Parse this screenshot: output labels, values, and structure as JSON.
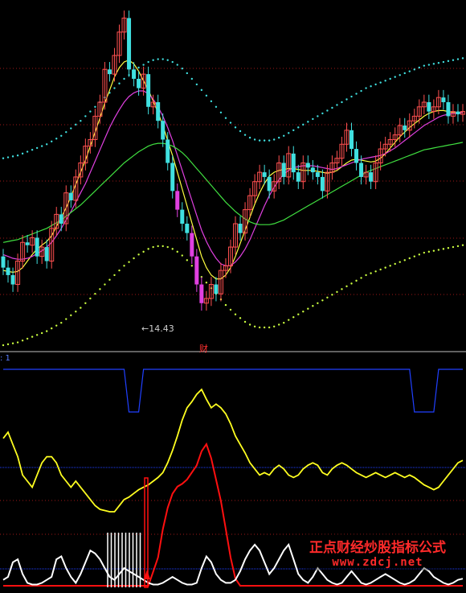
{
  "price_panel": {
    "min_label": "←14.43",
    "div_marker": "财"
  },
  "indicator_panel": {
    "tag": ": 1"
  },
  "watermark": {
    "chinese": "正点财经炒股指标公式",
    "url": "www.zdcj.net"
  },
  "colors": {
    "background": "#000000",
    "up_candle": "#ff5050",
    "down_candle": "#40e0e0",
    "big_down_candle": "#e040e0",
    "ma_short": "#ffff40",
    "ma_mid": "#e040e0",
    "ma_long": "#40e040",
    "band_upper": "#40e0e0",
    "band_lower": "#ccff40",
    "grid": "#a01818",
    "separator": "#c0c0c0",
    "ind_blue": "#2040ff",
    "ind_yellow": "#ffff20",
    "ind_red": "#ff1010",
    "ind_white": "#ffffff"
  },
  "chart_data": [
    {
      "type": "line",
      "title": "",
      "annotations": [
        "←14.43",
        "财"
      ],
      "x": [
        1,
        2,
        3,
        4,
        5,
        6,
        7,
        8,
        9,
        10,
        11,
        12,
        13,
        14,
        15,
        16,
        17,
        18,
        19,
        20,
        21,
        22,
        23,
        24,
        25,
        26,
        27,
        28,
        29,
        30,
        31,
        32,
        33,
        34,
        35,
        36,
        37,
        38,
        39,
        40,
        41,
        42,
        43,
        44,
        45,
        46,
        47,
        48,
        49,
        50,
        51,
        52,
        53,
        54,
        55,
        56,
        57,
        58,
        59,
        60,
        61,
        62,
        63,
        64,
        65,
        66,
        67,
        68,
        69,
        70,
        71,
        72,
        73,
        74,
        75,
        76,
        77,
        78,
        79,
        80,
        81,
        82,
        83,
        84,
        85,
        86,
        87,
        88,
        89,
        90,
        91,
        92,
        93,
        94,
        95,
        96
      ],
      "candles": {
        "open": [
          60,
          48,
          40,
          30,
          55,
          75,
          72,
          80,
          60,
          70,
          55,
          90,
          105,
          95,
          128,
          120,
          145,
          160,
          178,
          185,
          210,
          225,
          260,
          255,
          275,
          300,
          315,
          260,
          250,
          240,
          255,
          220,
          225,
          205,
          185,
          160,
          130,
          110,
          95,
          85,
          60,
          30,
          10,
          15,
          30,
          20,
          45,
          50,
          70,
          95,
          85,
          110,
          125,
          140,
          150,
          145,
          130,
          140,
          160,
          145,
          170,
          150,
          140,
          160,
          155,
          150,
          145,
          130,
          150,
          160,
          165,
          180,
          195,
          175,
          160,
          145,
          150,
          140,
          160,
          175,
          180,
          185,
          190,
          200,
          195,
          205,
          210,
          220,
          225,
          215,
          220,
          230,
          225,
          210,
          215,
          212
        ],
        "close": [
          48,
          40,
          30,
          55,
          75,
          72,
          80,
          60,
          70,
          55,
          90,
          105,
          95,
          128,
          120,
          145,
          160,
          178,
          185,
          210,
          225,
          260,
          255,
          275,
          300,
          315,
          260,
          250,
          240,
          255,
          220,
          225,
          205,
          185,
          160,
          130,
          110,
          95,
          85,
          60,
          30,
          10,
          15,
          30,
          20,
          45,
          50,
          70,
          95,
          85,
          110,
          125,
          140,
          150,
          145,
          130,
          140,
          160,
          145,
          170,
          150,
          140,
          160,
          155,
          150,
          145,
          130,
          150,
          160,
          165,
          180,
          195,
          175,
          160,
          145,
          150,
          140,
          160,
          175,
          180,
          185,
          190,
          200,
          195,
          205,
          210,
          220,
          225,
          215,
          220,
          230,
          225,
          210,
          215,
          212,
          215
        ]
      },
      "series": [
        {
          "name": "",
          "values": [
            45,
            44,
            43,
            44,
            48,
            55,
            62,
            68,
            72,
            76,
            82,
            92,
            102,
            112,
            124,
            137,
            150,
            163,
            178,
            193,
            208,
            224,
            238,
            252,
            262,
            268,
            270,
            266,
            258,
            248,
            238,
            226,
            214,
            200,
            184,
            168,
            150,
            132,
            114,
            96,
            78,
            60,
            48,
            40,
            36,
            36,
            40,
            48,
            60,
            74,
            88,
            102,
            116,
            128,
            138,
            146,
            150,
            152,
            153,
            154,
            154,
            153,
            152,
            152,
            152,
            151,
            150,
            149,
            150,
            152,
            156,
            160,
            163,
            164,
            163,
            162,
            161,
            162,
            165,
            170,
            176,
            182,
            188,
            193,
            198,
            202,
            206,
            210,
            213,
            215,
            216,
            216,
            215,
            214,
            214,
            214
          ]
        },
        {
          "name": "",
          "values": [
            62,
            60,
            58,
            57,
            57,
            58,
            60,
            63,
            66,
            70,
            75,
            82,
            90,
            99,
            108,
            118,
            128,
            138,
            150,
            162,
            174,
            186,
            198,
            208,
            217,
            225,
            231,
            235,
            237,
            237,
            234,
            228,
            220,
            210,
            198,
            184,
            168,
            152,
            136,
            120,
            104,
            88,
            76,
            66,
            58,
            52,
            50,
            50,
            54,
            60,
            68,
            78,
            90,
            102,
            114,
            125,
            134,
            142,
            148,
            152,
            155,
            156,
            157,
            157,
            157,
            156,
            155,
            154,
            153,
            154,
            156,
            158,
            160,
            162,
            164,
            165,
            166,
            167,
            168,
            170,
            173,
            176,
            180,
            184,
            188,
            192,
            196,
            200,
            203,
            206,
            209,
            211,
            212,
            213,
            213,
            214
          ]
        },
        {
          "name": "",
          "values": [
            75,
            76,
            77,
            78,
            80,
            82,
            84,
            86,
            88,
            90,
            93,
            96,
            99,
            103,
            107,
            111,
            115,
            120,
            125,
            130,
            135,
            140,
            145,
            150,
            155,
            160,
            164,
            168,
            172,
            175,
            178,
            180,
            181,
            181,
            180,
            178,
            175,
            171,
            166,
            160,
            154,
            148,
            142,
            136,
            130,
            124,
            118,
            113,
            108,
            104,
            100,
            97,
            95,
            94,
            94,
            94,
            95,
            97,
            99,
            102,
            105,
            108,
            111,
            114,
            117,
            120,
            123,
            126,
            129,
            132,
            135,
            138,
            141,
            144,
            147,
            150,
            152,
            154,
            156,
            158,
            160,
            162,
            164,
            166,
            168,
            170,
            172,
            174,
            175,
            176,
            177,
            178,
            179,
            180,
            181,
            182
          ]
        }
      ]
    },
    {
      "type": "line",
      "title": "",
      "x": [
        1,
        2,
        3,
        4,
        5,
        6,
        7,
        8,
        9,
        10,
        11,
        12,
        13,
        14,
        15,
        16,
        17,
        18,
        19,
        20,
        21,
        22,
        23,
        24,
        25,
        26,
        27,
        28,
        29,
        30,
        31,
        32,
        33,
        34,
        35,
        36,
        37,
        38,
        39,
        40,
        41,
        42,
        43,
        44,
        45,
        46,
        47,
        48,
        49,
        50,
        51,
        52,
        53,
        54,
        55,
        56,
        57,
        58,
        59,
        60,
        61,
        62,
        63,
        64,
        65,
        66,
        67,
        68,
        69,
        70,
        71,
        72,
        73,
        74,
        75,
        76,
        77,
        78,
        79,
        80,
        81,
        82,
        83,
        84,
        85,
        86,
        87,
        88,
        89,
        90,
        91,
        92,
        93,
        94,
        95,
        96
      ],
      "series": [
        {
          "name": "",
          "values": [
            1,
            1,
            1,
            1,
            1,
            1,
            1,
            1,
            1,
            1,
            1,
            1,
            1,
            1,
            1,
            1,
            1,
            1,
            1,
            1,
            1,
            1,
            1,
            1,
            1,
            1,
            0,
            0,
            0,
            1,
            1,
            1,
            1,
            1,
            1,
            1,
            1,
            1,
            1,
            1,
            1,
            1,
            1,
            1,
            1,
            1,
            1,
            1,
            1,
            1,
            1,
            1,
            1,
            1,
            1,
            1,
            1,
            1,
            1,
            1,
            1,
            1,
            1,
            1,
            1,
            1,
            1,
            1,
            1,
            1,
            1,
            1,
            1,
            1,
            1,
            1,
            1,
            1,
            1,
            1,
            1,
            1,
            1,
            1,
            1,
            0,
            0,
            0,
            0,
            0,
            1,
            1,
            1,
            1,
            1,
            1
          ]
        },
        {
          "name": "",
          "values": [
            0.6,
            0.65,
            0.55,
            0.45,
            0.3,
            0.25,
            0.2,
            0.3,
            0.4,
            0.45,
            0.45,
            0.4,
            0.3,
            0.25,
            0.2,
            0.25,
            0.2,
            0.15,
            0.1,
            0.05,
            0.02,
            0.01,
            0.0,
            0.0,
            0.05,
            0.1,
            0.12,
            0.15,
            0.18,
            0.2,
            0.22,
            0.25,
            0.28,
            0.32,
            0.4,
            0.5,
            0.62,
            0.75,
            0.85,
            0.9,
            0.96,
            1.0,
            0.92,
            0.85,
            0.88,
            0.85,
            0.8,
            0.72,
            0.62,
            0.55,
            0.48,
            0.4,
            0.35,
            0.3,
            0.32,
            0.3,
            0.35,
            0.38,
            0.35,
            0.3,
            0.28,
            0.3,
            0.35,
            0.38,
            0.4,
            0.38,
            0.32,
            0.3,
            0.35,
            0.38,
            0.4,
            0.38,
            0.35,
            0.32,
            0.3,
            0.28,
            0.3,
            0.32,
            0.3,
            0.28,
            0.3,
            0.32,
            0.3,
            0.28,
            0.3,
            0.28,
            0.25,
            0.22,
            0.2,
            0.18,
            0.2,
            0.25,
            0.3,
            0.35,
            0.4,
            0.42
          ]
        },
        {
          "name": "",
          "values": [
            0,
            0,
            0,
            0,
            0,
            0,
            0,
            0,
            0,
            0,
            0,
            0,
            0,
            0,
            0,
            0,
            0,
            0,
            0,
            0,
            0,
            0,
            0,
            0,
            0,
            0,
            0,
            0,
            0,
            0,
            0,
            0.1,
            0.2,
            0.4,
            0.55,
            0.65,
            0.7,
            0.72,
            0.75,
            0.8,
            0.85,
            0.95,
            1.0,
            0.9,
            0.75,
            0.6,
            0.4,
            0.2,
            0.05,
            0,
            0,
            0,
            0,
            0,
            0,
            0,
            0,
            0,
            0,
            0,
            0,
            0,
            0,
            0,
            0,
            0,
            0,
            0,
            0,
            0,
            0,
            0,
            0,
            0,
            0,
            0,
            0,
            0,
            0,
            0,
            0,
            0,
            0,
            0,
            0,
            0,
            0,
            0,
            0,
            0,
            0,
            0,
            0,
            0,
            0,
            0
          ]
        },
        {
          "name": "",
          "values": [
            0.1,
            0.15,
            0.4,
            0.45,
            0.2,
            0.05,
            0.02,
            0.02,
            0.05,
            0.1,
            0.15,
            0.45,
            0.5,
            0.3,
            0.15,
            0.05,
            0.2,
            0.4,
            0.6,
            0.55,
            0.45,
            0.3,
            0.15,
            0.1,
            0.2,
            0.3,
            0.25,
            0.2,
            0.15,
            0.1,
            0.05,
            0.02,
            0.02,
            0.05,
            0.1,
            0.15,
            0.1,
            0.05,
            0.02,
            0.02,
            0.05,
            0.3,
            0.5,
            0.4,
            0.2,
            0.1,
            0.05,
            0.05,
            0.1,
            0.25,
            0.45,
            0.6,
            0.7,
            0.6,
            0.4,
            0.2,
            0.3,
            0.45,
            0.6,
            0.7,
            0.45,
            0.2,
            0.1,
            0.05,
            0.15,
            0.3,
            0.2,
            0.1,
            0.05,
            0.02,
            0.05,
            0.15,
            0.25,
            0.15,
            0.05,
            0.02,
            0.05,
            0.1,
            0.15,
            0.2,
            0.15,
            0.1,
            0.05,
            0.02,
            0.05,
            0.1,
            0.2,
            0.3,
            0.25,
            0.15,
            0.1,
            0.05,
            0.02,
            0.05,
            0.1,
            0.12
          ]
        }
      ]
    }
  ]
}
